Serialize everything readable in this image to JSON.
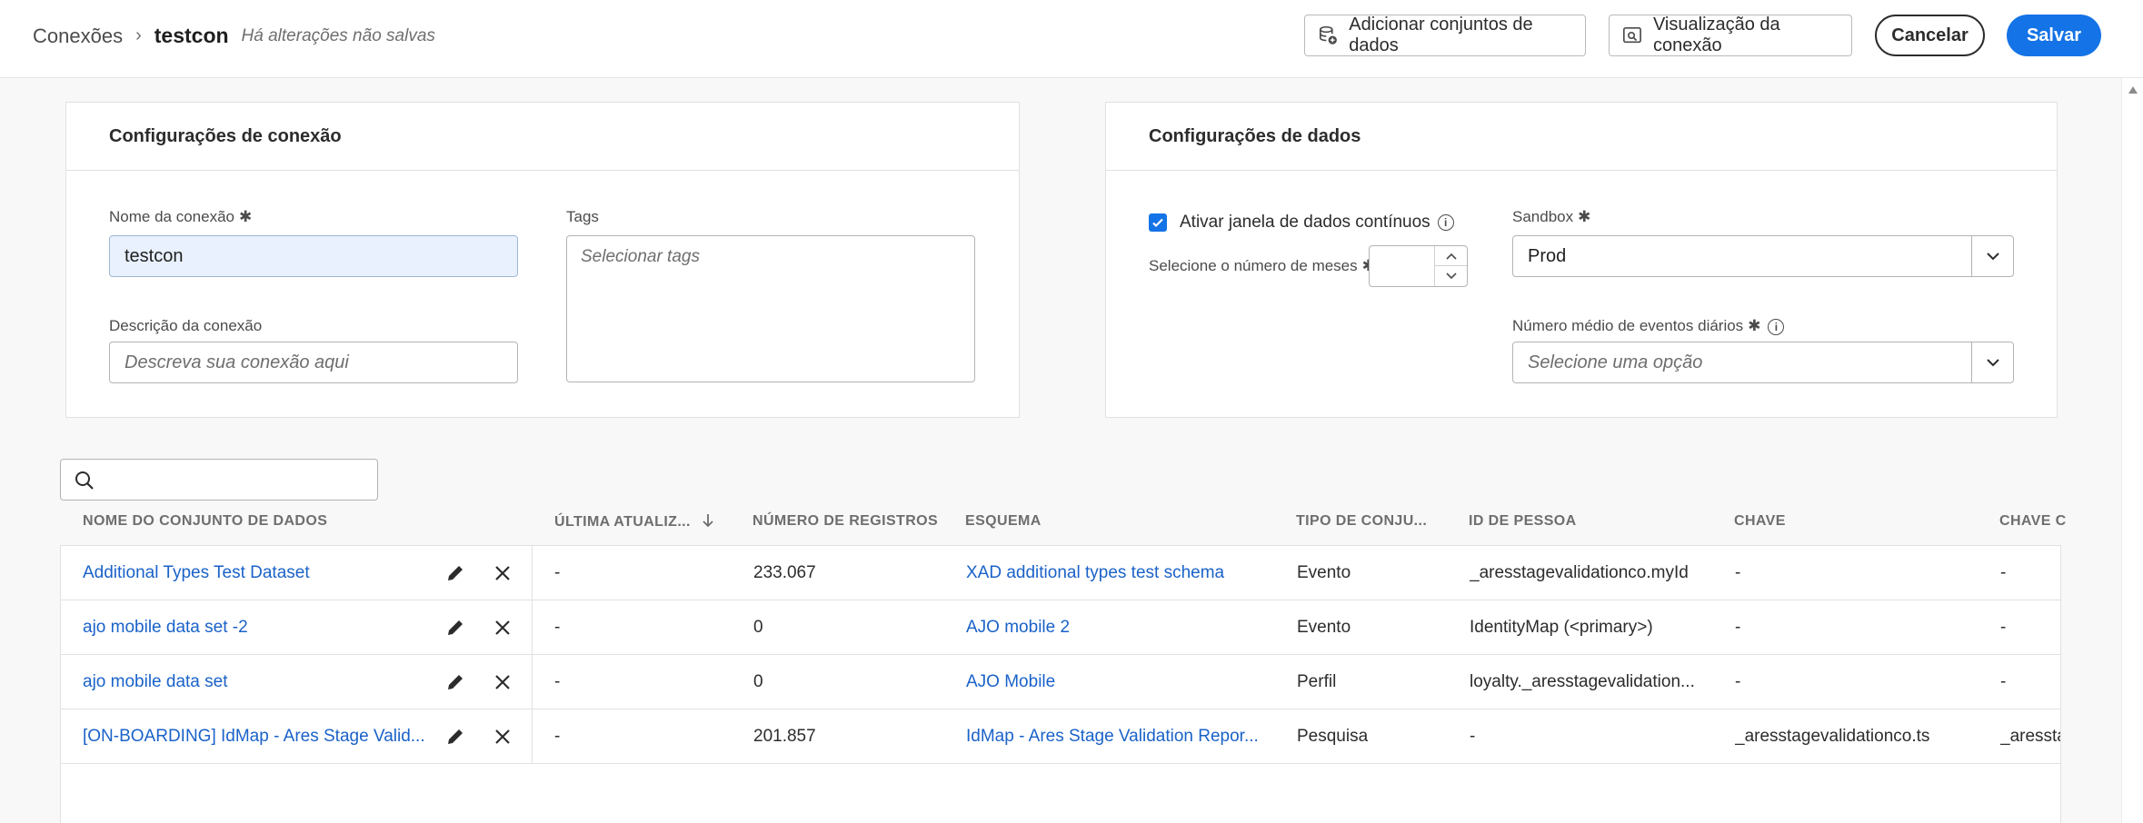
{
  "header": {
    "breadcrumb_root": "Conexões",
    "breadcrumb_current": "testcon",
    "unsaved": "Há alterações não salvas",
    "add_datasets": "Adicionar conjuntos de dados",
    "preview": "Visualização da conexão",
    "cancel": "Cancelar",
    "save": "Salvar"
  },
  "connection_settings": {
    "title": "Configurações de conexão",
    "name_label": "Nome da conexão",
    "name_value": "testcon",
    "tags_label": "Tags",
    "tags_placeholder": "Selecionar tags",
    "desc_label": "Descrição da conexão",
    "desc_placeholder": "Descreva sua conexão aqui"
  },
  "data_settings": {
    "title": "Configurações de dados",
    "rolling_label": "Ativar janela de dados contínuos",
    "rolling_checked": true,
    "months_label": "Selecione o número de meses",
    "sandbox_label": "Sandbox",
    "sandbox_value": "Prod",
    "events_label": "Número médio de eventos diários",
    "events_placeholder": "Selecione uma opção"
  },
  "table": {
    "columns": [
      "NOME DO CONJUNTO DE DADOS",
      "ÚLTIMA ATUALIZ...",
      "NÚMERO DE REGISTROS",
      "ESQUEMA",
      "TIPO DE CONJU...",
      "ID DE PESSOA",
      "CHAVE",
      "CHAVE C"
    ],
    "rows": [
      {
        "name": "Additional Types Test Dataset",
        "updated": "-",
        "records": "233.067",
        "schema": "XAD additional types test schema",
        "type": "Evento",
        "person_id": "_aresstagevalidationco.myId",
        "key": "-",
        "match_key": "-"
      },
      {
        "name": "ajo mobile data set -2",
        "updated": "-",
        "records": "0",
        "schema": "AJO mobile 2",
        "type": "Evento",
        "person_id": "IdentityMap (<primary>)",
        "key": "-",
        "match_key": "-"
      },
      {
        "name": "ajo mobile data set",
        "updated": "-",
        "records": "0",
        "schema": "AJO Mobile",
        "type": "Perfil",
        "person_id": "loyalty._aresstagevalidation...",
        "key": "-",
        "match_key": "-"
      },
      {
        "name": "[ON-BOARDING] IdMap - Ares Stage Valid...",
        "updated": "-",
        "records": "201.857",
        "schema": "IdMap - Ares Stage Validation Repor...",
        "type": "Pesquisa",
        "person_id": "-",
        "key": "_aresstagevalidationco.ts",
        "match_key": "_aressta"
      }
    ]
  },
  "icons": {
    "add_datasets": "database-add-icon",
    "preview": "preview-icon",
    "search": "search-icon",
    "edit": "pencil-icon",
    "remove": "close-icon",
    "sort": "arrow-down-icon"
  },
  "colors": {
    "accent": "#1473e6",
    "link": "#1a62c9"
  }
}
